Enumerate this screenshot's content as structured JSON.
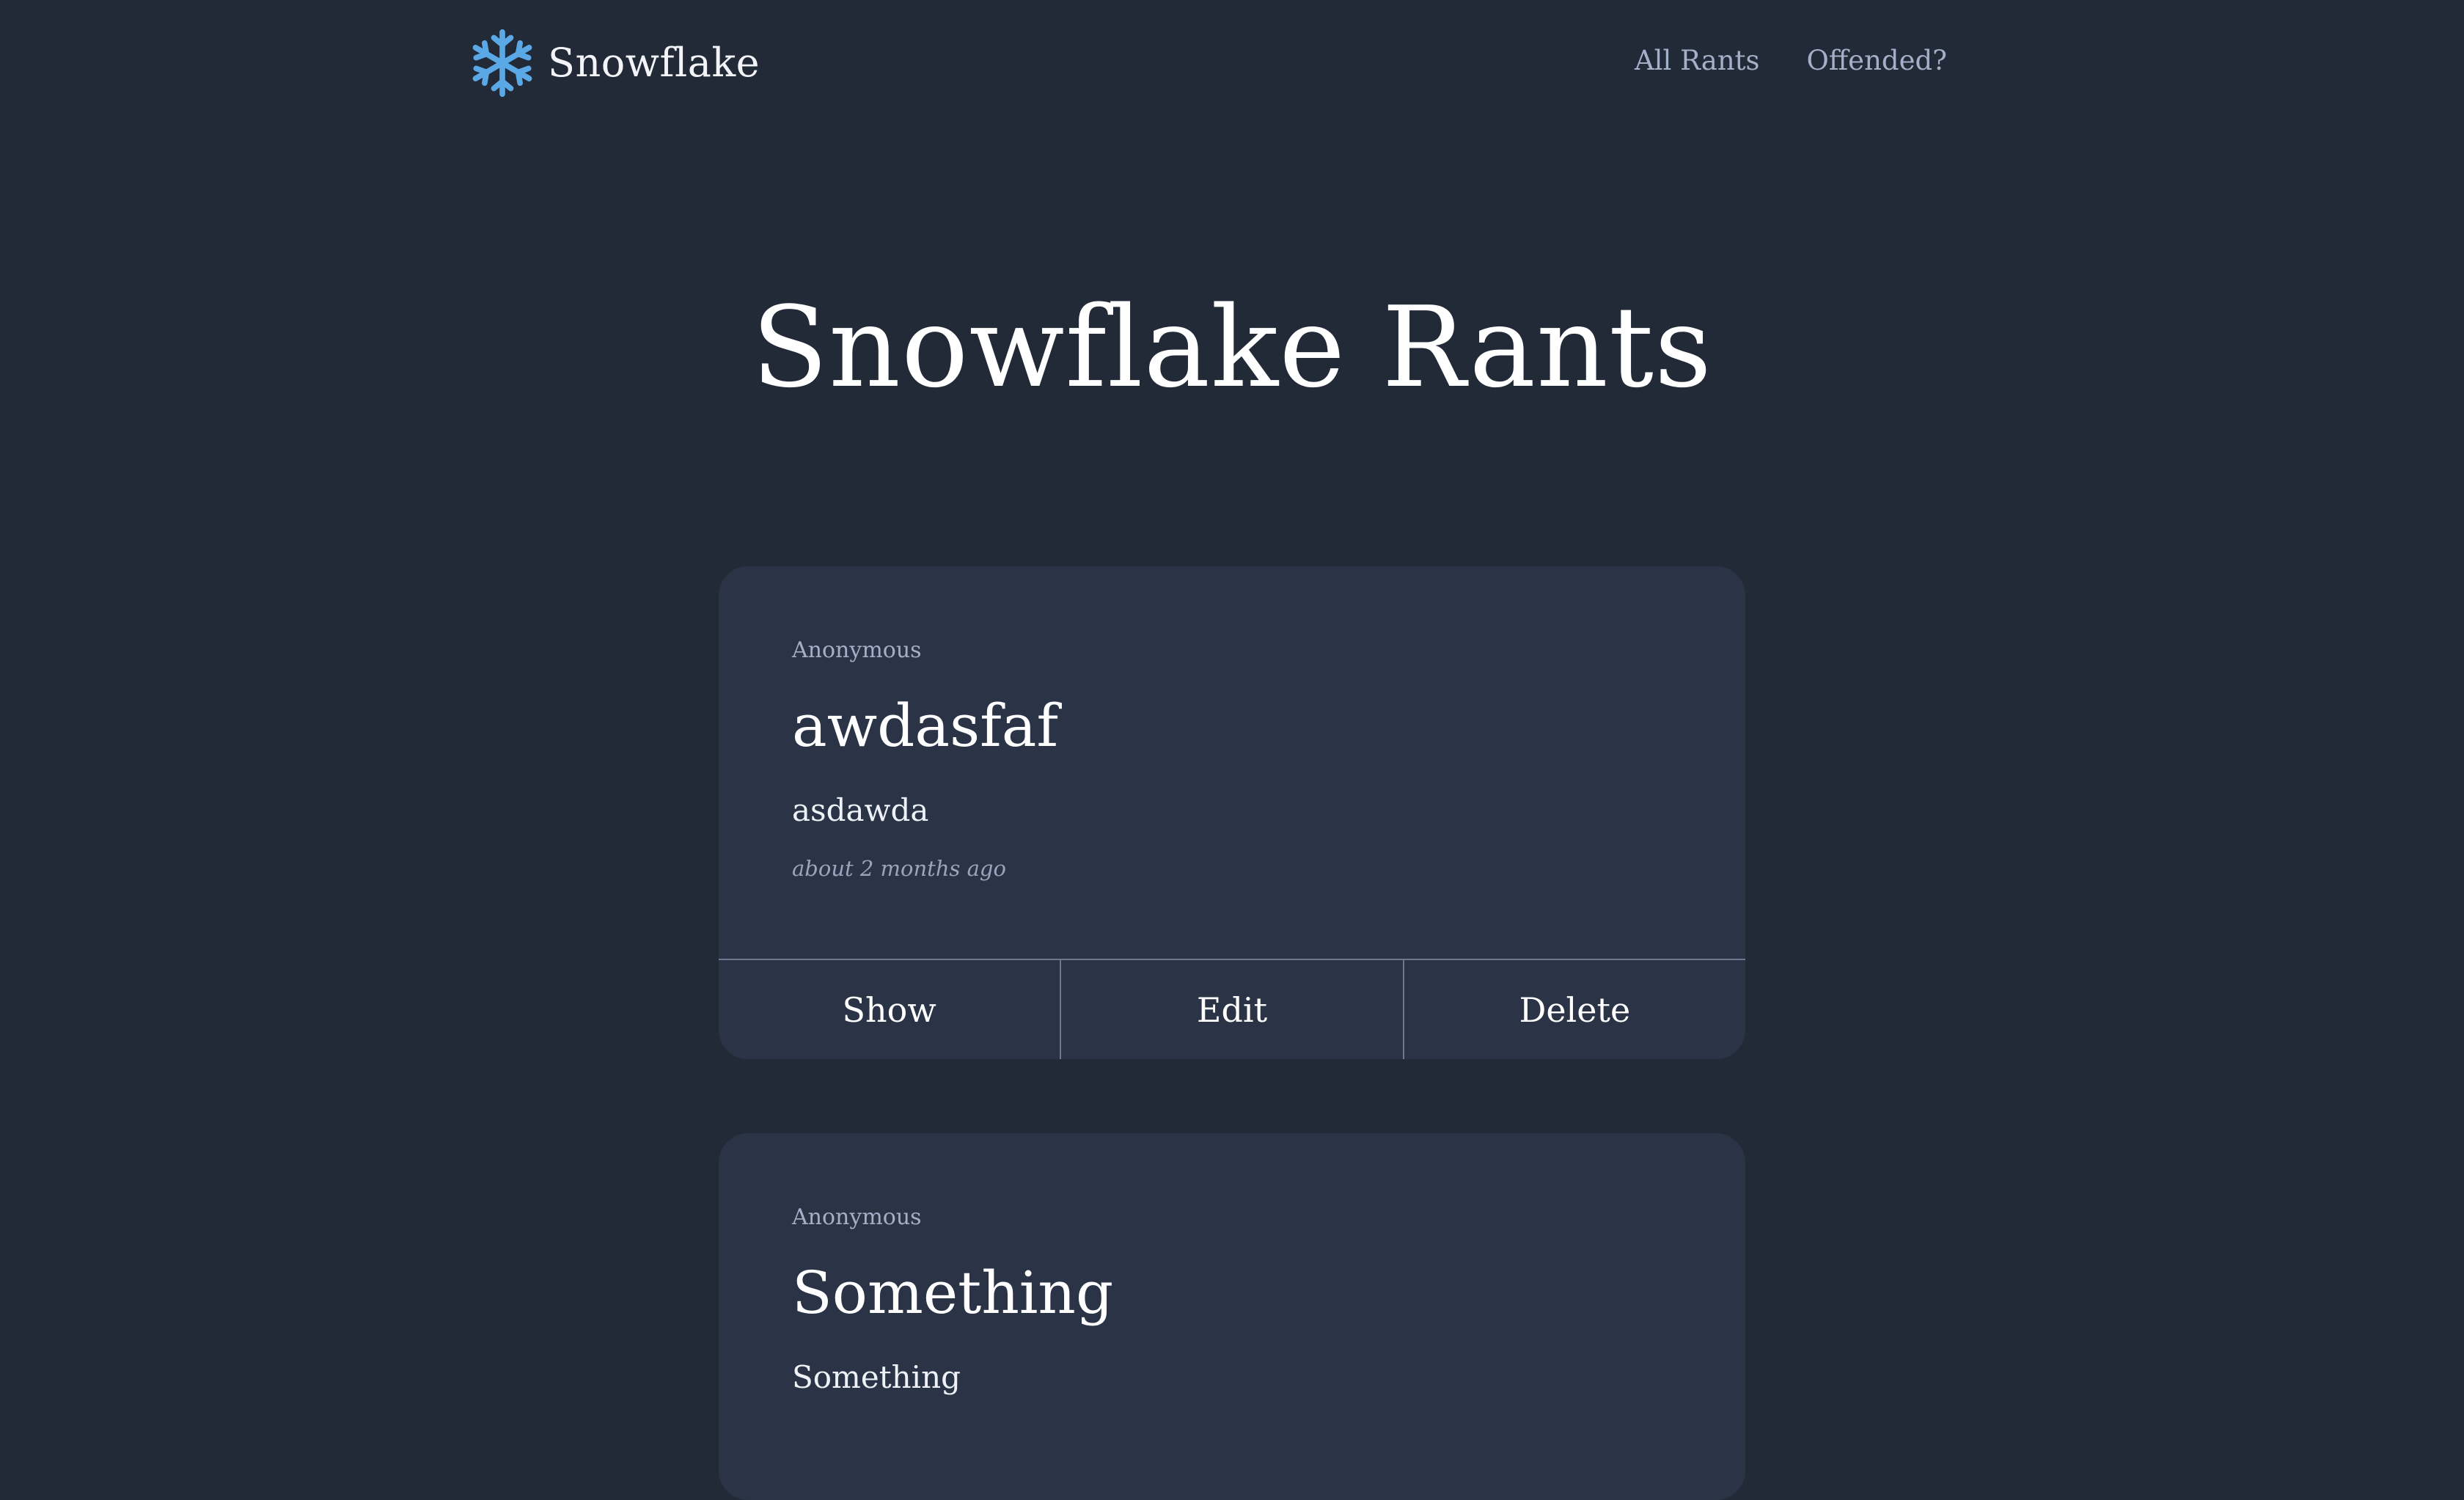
{
  "navbar": {
    "brand_name": "Snowflake",
    "brand_icon": "snowflake-icon",
    "links": [
      {
        "label": "All Rants"
      },
      {
        "label": "Offended?"
      }
    ]
  },
  "page": {
    "title": "Snowflake Rants"
  },
  "rants": [
    {
      "author": "Anonymous",
      "title": "awdasfaf",
      "content": "asdawda",
      "time": "about 2 months ago",
      "actions": {
        "show": "Show",
        "edit": "Edit",
        "delete": "Delete"
      }
    },
    {
      "author": "Anonymous",
      "title": "Something",
      "content": "Something"
    }
  ],
  "colors": {
    "background": "#222a38",
    "card": "#2b3447",
    "muted_text": "#a3b0c8",
    "snowflake_icon": "#5aa9e6"
  }
}
